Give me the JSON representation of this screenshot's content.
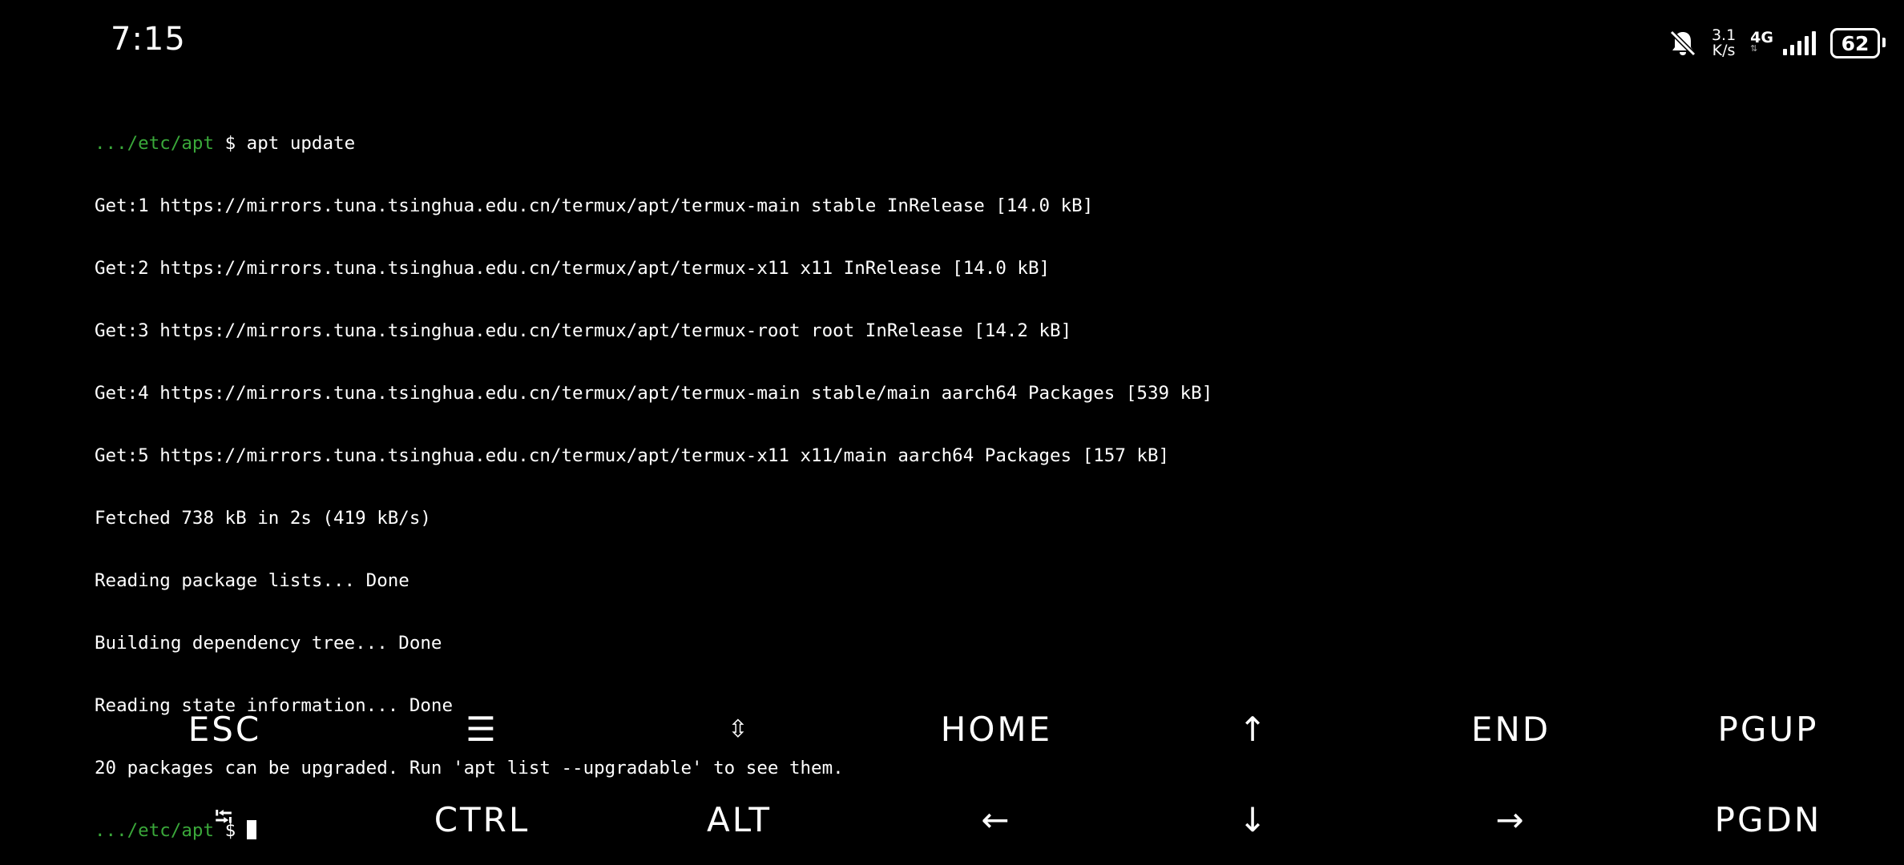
{
  "status_bar": {
    "time": "7:15",
    "speed_value": "3.1",
    "speed_unit": "K/s",
    "network_type": "4G",
    "battery_level": "62",
    "icons": [
      "bell-muted-icon",
      "signal-icon",
      "battery-icon"
    ]
  },
  "terminal": {
    "prompt_path": ".../etc/apt",
    "prompt_symbol": "$",
    "command": "apt update",
    "output": [
      "Get:1 https://mirrors.tuna.tsinghua.edu.cn/termux/apt/termux-main stable InRelease [14.0 kB]",
      "Get:2 https://mirrors.tuna.tsinghua.edu.cn/termux/apt/termux-x11 x11 InRelease [14.0 kB]",
      "Get:3 https://mirrors.tuna.tsinghua.edu.cn/termux/apt/termux-root root InRelease [14.2 kB]",
      "Get:4 https://mirrors.tuna.tsinghua.edu.cn/termux/apt/termux-main stable/main aarch64 Packages [539 kB]",
      "Get:5 https://mirrors.tuna.tsinghua.edu.cn/termux/apt/termux-x11 x11/main aarch64 Packages [157 kB]",
      "Fetched 738 kB in 2s (419 kB/s)",
      "Reading package lists... Done",
      "Building dependency tree... Done",
      "Reading state information... Done",
      "20 packages can be upgraded. Run 'apt list --upgradable' to see them."
    ]
  },
  "extra_keys": {
    "row1": [
      {
        "label": "ESC",
        "name": "key-esc"
      },
      {
        "label": "☰",
        "name": "key-menu-icon"
      },
      {
        "label": "⇳",
        "name": "key-updown-icon"
      },
      {
        "label": "HOME",
        "name": "key-home"
      },
      {
        "label": "↑",
        "name": "key-up-arrow-icon"
      },
      {
        "label": "END",
        "name": "key-end"
      },
      {
        "label": "PGUP",
        "name": "key-pgup"
      }
    ],
    "row2": [
      {
        "label": "⭾",
        "name": "key-tab-icon"
      },
      {
        "label": "CTRL",
        "name": "key-ctrl"
      },
      {
        "label": "ALT",
        "name": "key-alt"
      },
      {
        "label": "←",
        "name": "key-left-arrow-icon"
      },
      {
        "label": "↓",
        "name": "key-down-arrow-icon"
      },
      {
        "label": "→",
        "name": "key-right-arrow-icon"
      },
      {
        "label": "PGDN",
        "name": "key-pgdn"
      }
    ]
  }
}
